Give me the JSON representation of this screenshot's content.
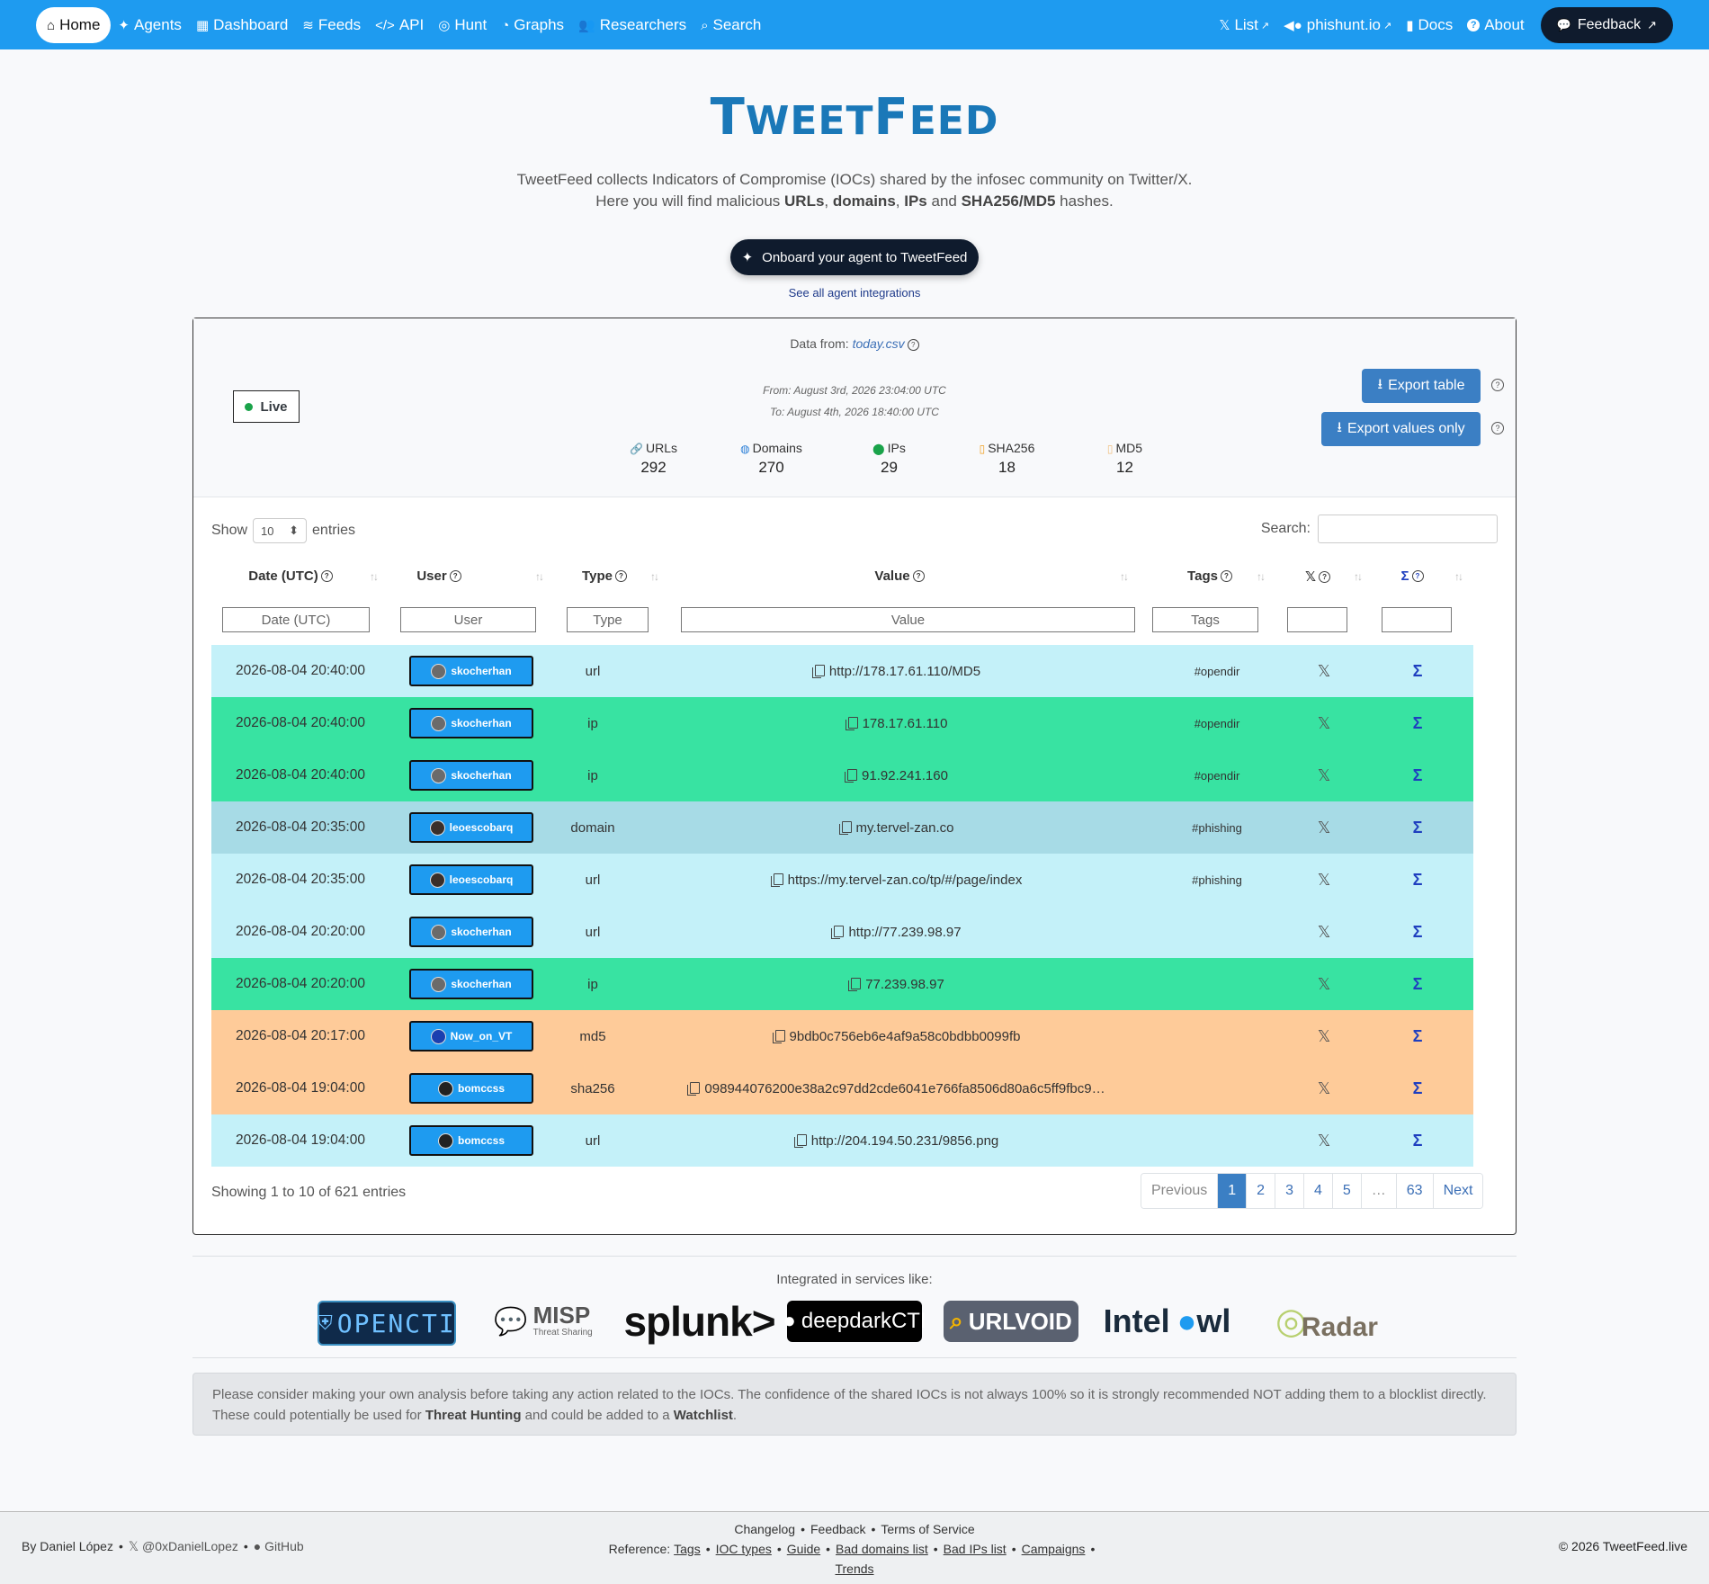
{
  "nav": {
    "left": [
      {
        "icon": "home-icon",
        "glyph": "⌂",
        "label": "Home"
      },
      {
        "icon": "sparkle-icon",
        "glyph": "✦",
        "label": "Agents"
      },
      {
        "icon": "grid-icon",
        "glyph": "▦",
        "label": "Dashboard"
      },
      {
        "icon": "rss-icon",
        "glyph": "≋",
        "label": "Feeds"
      },
      {
        "icon": "code-icon",
        "glyph": "</>",
        "label": "API"
      },
      {
        "icon": "target-icon",
        "glyph": "◎",
        "label": "Hunt"
      },
      {
        "icon": "pie-chart-icon",
        "glyph": "◔",
        "label": "Graphs"
      },
      {
        "icon": "users-icon",
        "glyph": "👥",
        "label": "Researchers"
      },
      {
        "icon": "search-icon",
        "glyph": "⌕",
        "label": "Search"
      }
    ],
    "right": [
      {
        "icon": "x-logo-icon",
        "glyph": "𝕏",
        "label": "List",
        "ext": "↗"
      },
      {
        "icon": "fish-icon",
        "glyph": "◀●",
        "label": "phishunt.io",
        "ext": "↗"
      },
      {
        "icon": "book-icon",
        "glyph": "▮",
        "label": "Docs"
      },
      {
        "icon": "question-circle-icon",
        "glyph": "?",
        "label": "About"
      }
    ],
    "feedback": "Feedback"
  },
  "hero": {
    "brand_a": "T",
    "brand_b": "WEET",
    "brand_c": "F",
    "brand_d": "EED",
    "tagline1": "TweetFeed collects Indicators of Compromise (IOCs) shared by the infosec community on Twitter/X.",
    "tagline2_pre": "Here you will find malicious ",
    "urls": "URLs",
    "domains": "domains",
    "ips": "IPs",
    "and": " and ",
    "hashes": "SHA256/MD5",
    "hashes_suffix": " hashes.",
    "onboard": "Onboard your agent to TweetFeed",
    "integrations": "See all agent integrations"
  },
  "card": {
    "data_from_label": "Data from: ",
    "data_from_file": "today.csv",
    "live": "Live",
    "from": "From: August 3rd, 2026 23:04:00 UTC",
    "to": "To: August 4th, 2026 18:40:00 UTC",
    "stats": [
      {
        "icon": "link-icon",
        "glyph": "🔗",
        "label": "URLs",
        "value": "292",
        "color": "#2a5bd7"
      },
      {
        "icon": "globe-icon",
        "glyph": "◍",
        "label": "Domains",
        "value": "270",
        "color": "#2a7fd7"
      },
      {
        "icon": "map-pin-icon",
        "glyph": "⬤",
        "label": "IPs",
        "value": "29",
        "color": "#1aa34a"
      },
      {
        "icon": "file-icon",
        "glyph": "▯",
        "label": "SHA256",
        "value": "18",
        "color": "#f0a020"
      },
      {
        "icon": "file-icon",
        "glyph": "▯",
        "label": "MD5",
        "value": "12",
        "color": "#f0c080"
      }
    ],
    "export_table": "Export table",
    "export_values": "Export values only"
  },
  "table": {
    "show": "Show",
    "entries": "entries",
    "page_size": "10",
    "search_label": "Search:",
    "headers": {
      "date": "Date (UTC)",
      "user": "User",
      "type": "Type",
      "value": "Value",
      "tags": "Tags"
    },
    "filters": {
      "date": "Date (UTC)",
      "user": "User",
      "type": "Type",
      "value": "Value",
      "tags": "Tags"
    },
    "rows": [
      {
        "date": "2026-08-04 20:40:00",
        "user": "skocherhan",
        "type": "url",
        "value": "http://178.17.61.110/MD5",
        "tags": "#opendir",
        "kind": "url"
      },
      {
        "date": "2026-08-04 20:40:00",
        "user": "skocherhan",
        "type": "ip",
        "value": "178.17.61.110",
        "tags": "#opendir",
        "kind": "ip"
      },
      {
        "date": "2026-08-04 20:40:00",
        "user": "skocherhan",
        "type": "ip",
        "value": "91.92.241.160",
        "tags": "#opendir",
        "kind": "ip"
      },
      {
        "date": "2026-08-04 20:35:00",
        "user": "leoescobarq",
        "type": "domain",
        "value": "my.tervel-zan.co",
        "tags": "#phishing",
        "kind": "domain"
      },
      {
        "date": "2026-08-04 20:35:00",
        "user": "leoescobarq",
        "type": "url",
        "value": "https://my.tervel-zan.co/tp/#/page/index",
        "tags": "#phishing",
        "kind": "url"
      },
      {
        "date": "2026-08-04 20:20:00",
        "user": "skocherhan",
        "type": "url",
        "value": "http://77.239.98.97",
        "tags": "",
        "kind": "url"
      },
      {
        "date": "2026-08-04 20:20:00",
        "user": "skocherhan",
        "type": "ip",
        "value": "77.239.98.97",
        "tags": "",
        "kind": "ip"
      },
      {
        "date": "2026-08-04 20:17:00",
        "user": "Now_on_VT",
        "type": "md5",
        "value": "9bdb0c756eb6e4af9a58c0bdbb0099fb",
        "tags": "",
        "kind": "hash"
      },
      {
        "date": "2026-08-04 19:04:00",
        "user": "bomccss",
        "type": "sha256",
        "value": "098944076200e38a2c97dd2cde6041e766fa8506d80a6c5ff9fbc9…",
        "tags": "",
        "kind": "hash"
      },
      {
        "date": "2026-08-04 19:04:00",
        "user": "bomccss",
        "type": "url",
        "value": "http://204.194.50.231/9856.png",
        "tags": "",
        "kind": "url"
      }
    ],
    "showing": "Showing 1 to 10 of 621 entries",
    "pages": [
      "Previous",
      "1",
      "2",
      "3",
      "4",
      "5",
      "…",
      "63",
      "Next"
    ]
  },
  "services": {
    "label": "Integrated in services like:",
    "logos": [
      "OPENCTI",
      "MISP",
      "Threat Sharing",
      "splunk>",
      "deepdarkCTI",
      "URLVOID",
      "Intel",
      "wl",
      "Radar"
    ]
  },
  "warning": {
    "text1": "Please consider making your own analysis before taking any action related to the IOCs. The confidence of the shared IOCs is not always 100% so it is strongly recommended NOT adding them to a blocklist directly. These could potentially be used for ",
    "threat": "Threat Hunting",
    "text2": " and could be added to a ",
    "watch": "Watchlist",
    "text3": "."
  },
  "footer": {
    "author": "By Daniel López",
    "x_handle": "@0xDanielLopez",
    "github": "GitHub",
    "links1": [
      "Changelog",
      "Feedback",
      "Terms of Service"
    ],
    "reference": "Reference:",
    "links2": [
      "Tags",
      "IOC types",
      "Guide",
      "Bad domains list",
      "Bad IPs list",
      "Campaigns"
    ],
    "trends": "Trends",
    "copyright": "© 2026 TweetFeed.live"
  }
}
